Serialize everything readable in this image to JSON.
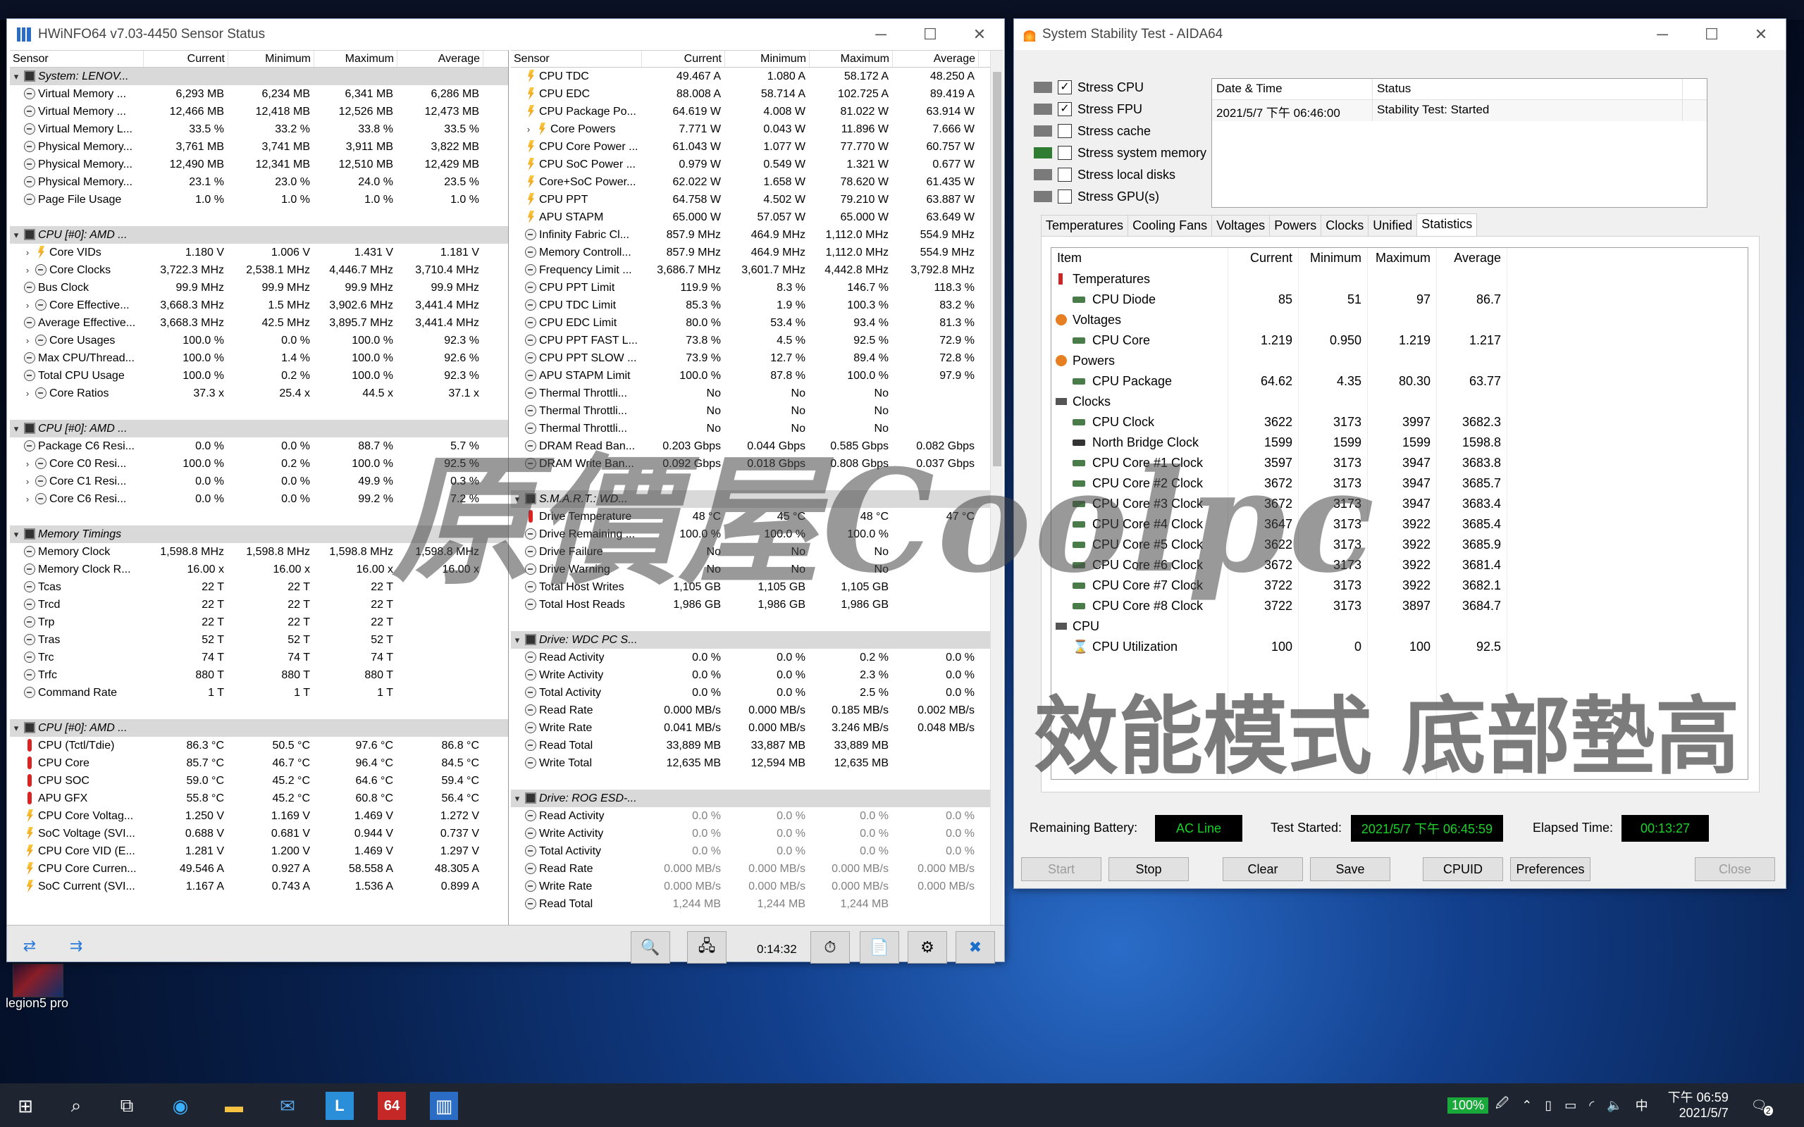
{
  "hwinfo": {
    "title": "HWiNFO64 v7.03-4450 Sensor Status",
    "headers": [
      "Sensor",
      "Current",
      "Minimum",
      "Maximum",
      "Average"
    ],
    "left": [
      {
        "t": "grp",
        "l": "System: LENOV..."
      },
      {
        "t": "clock",
        "l": "Virtual Memory ...",
        "v": [
          "6,293 MB",
          "6,234 MB",
          "6,341 MB",
          "6,286 MB"
        ]
      },
      {
        "t": "clock",
        "l": "Virtual Memory ...",
        "v": [
          "12,466 MB",
          "12,418 MB",
          "12,526 MB",
          "12,473 MB"
        ]
      },
      {
        "t": "clock",
        "l": "Virtual Memory L...",
        "v": [
          "33.5 %",
          "33.2 %",
          "33.8 %",
          "33.5 %"
        ]
      },
      {
        "t": "clock",
        "l": "Physical Memory...",
        "v": [
          "3,761 MB",
          "3,741 MB",
          "3,911 MB",
          "3,822 MB"
        ]
      },
      {
        "t": "clock",
        "l": "Physical Memory...",
        "v": [
          "12,490 MB",
          "12,341 MB",
          "12,510 MB",
          "12,429 MB"
        ]
      },
      {
        "t": "clock",
        "l": "Physical Memory...",
        "v": [
          "23.1 %",
          "23.0 %",
          "24.0 %",
          "23.5 %"
        ]
      },
      {
        "t": "clock",
        "l": "Page File Usage",
        "v": [
          "1.0 %",
          "1.0 %",
          "1.0 %",
          "1.0 %"
        ]
      },
      {
        "t": "blank"
      },
      {
        "t": "grp",
        "l": "CPU [#0]: AMD ..."
      },
      {
        "t": "bolt",
        "x": true,
        "l": "Core VIDs",
        "v": [
          "1.180 V",
          "1.006 V",
          "1.431 V",
          "1.181 V"
        ]
      },
      {
        "t": "clock",
        "x": true,
        "l": "Core Clocks",
        "v": [
          "3,722.3 MHz",
          "2,538.1 MHz",
          "4,446.7 MHz",
          "3,710.4 MHz"
        ]
      },
      {
        "t": "clock",
        "l": "Bus Clock",
        "v": [
          "99.9 MHz",
          "99.9 MHz",
          "99.9 MHz",
          "99.9 MHz"
        ]
      },
      {
        "t": "clock",
        "x": true,
        "l": "Core Effective...",
        "v": [
          "3,668.3 MHz",
          "1.5 MHz",
          "3,902.6 MHz",
          "3,441.4 MHz"
        ]
      },
      {
        "t": "clock",
        "l": "Average Effective...",
        "v": [
          "3,668.3 MHz",
          "42.5 MHz",
          "3,895.7 MHz",
          "3,441.4 MHz"
        ]
      },
      {
        "t": "clock",
        "x": true,
        "l": "Core Usages",
        "v": [
          "100.0 %",
          "0.0 %",
          "100.0 %",
          "92.3 %"
        ]
      },
      {
        "t": "clock",
        "l": "Max CPU/Thread...",
        "v": [
          "100.0 %",
          "1.4 %",
          "100.0 %",
          "92.6 %"
        ]
      },
      {
        "t": "clock",
        "l": "Total CPU Usage",
        "v": [
          "100.0 %",
          "0.2 %",
          "100.0 %",
          "92.3 %"
        ]
      },
      {
        "t": "clock",
        "x": true,
        "l": "Core Ratios",
        "v": [
          "37.3 x",
          "25.4 x",
          "44.5 x",
          "37.1 x"
        ]
      },
      {
        "t": "blank"
      },
      {
        "t": "grp",
        "l": "CPU [#0]: AMD ..."
      },
      {
        "t": "clock",
        "l": "Package C6 Resi...",
        "v": [
          "0.0 %",
          "0.0 %",
          "88.7 %",
          "5.7 %"
        ]
      },
      {
        "t": "clock",
        "x": true,
        "l": "Core C0 Resi...",
        "v": [
          "100.0 %",
          "0.2 %",
          "100.0 %",
          "92.5 %"
        ]
      },
      {
        "t": "clock",
        "x": true,
        "l": "Core C1 Resi...",
        "v": [
          "0.0 %",
          "0.0 %",
          "49.9 %",
          "0.3 %"
        ]
      },
      {
        "t": "clock",
        "x": true,
        "l": "Core C6 Resi...",
        "v": [
          "0.0 %",
          "0.0 %",
          "99.2 %",
          "7.2 %"
        ]
      },
      {
        "t": "blank"
      },
      {
        "t": "grp",
        "l": "Memory Timings"
      },
      {
        "t": "clock",
        "l": "Memory Clock",
        "v": [
          "1,598.8 MHz",
          "1,598.8 MHz",
          "1,598.8 MHz",
          "1,598.8 MHz"
        ]
      },
      {
        "t": "clock",
        "l": "Memory Clock R...",
        "v": [
          "16.00 x",
          "16.00 x",
          "16.00 x",
          "16.00 x"
        ]
      },
      {
        "t": "clock",
        "l": "Tcas",
        "v": [
          "22 T",
          "22 T",
          "22 T",
          ""
        ]
      },
      {
        "t": "clock",
        "l": "Trcd",
        "v": [
          "22 T",
          "22 T",
          "22 T",
          ""
        ]
      },
      {
        "t": "clock",
        "l": "Trp",
        "v": [
          "22 T",
          "22 T",
          "22 T",
          ""
        ]
      },
      {
        "t": "clock",
        "l": "Tras",
        "v": [
          "52 T",
          "52 T",
          "52 T",
          ""
        ]
      },
      {
        "t": "clock",
        "l": "Trc",
        "v": [
          "74 T",
          "74 T",
          "74 T",
          ""
        ]
      },
      {
        "t": "clock",
        "l": "Trfc",
        "v": [
          "880 T",
          "880 T",
          "880 T",
          ""
        ]
      },
      {
        "t": "clock",
        "l": "Command Rate",
        "v": [
          "1 T",
          "1 T",
          "1 T",
          ""
        ]
      },
      {
        "t": "blank"
      },
      {
        "t": "grp",
        "l": "CPU [#0]: AMD ..."
      },
      {
        "t": "therm",
        "l": "CPU (Tctl/Tdie)",
        "v": [
          "86.3 °C",
          "50.5 °C",
          "97.6 °C",
          "86.8 °C"
        ]
      },
      {
        "t": "therm",
        "l": "CPU Core",
        "v": [
          "85.7 °C",
          "46.7 °C",
          "96.4 °C",
          "84.5 °C"
        ]
      },
      {
        "t": "therm",
        "l": "CPU SOC",
        "v": [
          "59.0 °C",
          "45.2 °C",
          "64.6 °C",
          "59.4 °C"
        ]
      },
      {
        "t": "therm",
        "l": "APU GFX",
        "v": [
          "55.8 °C",
          "45.2 °C",
          "60.8 °C",
          "56.4 °C"
        ]
      },
      {
        "t": "bolt",
        "l": "CPU Core Voltag...",
        "v": [
          "1.250 V",
          "1.169 V",
          "1.469 V",
          "1.272 V"
        ]
      },
      {
        "t": "bolt",
        "l": "SoC Voltage (SVI...",
        "v": [
          "0.688 V",
          "0.681 V",
          "0.944 V",
          "0.737 V"
        ]
      },
      {
        "t": "bolt",
        "l": "CPU Core VID (E...",
        "v": [
          "1.281 V",
          "1.200 V",
          "1.469 V",
          "1.297 V"
        ]
      },
      {
        "t": "bolt",
        "l": "CPU Core Curren...",
        "v": [
          "49.546 A",
          "0.927 A",
          "58.558 A",
          "48.305 A"
        ]
      },
      {
        "t": "bolt",
        "l": "SoC Current (SVI...",
        "v": [
          "1.167 A",
          "0.743 A",
          "1.536 A",
          "0.899 A"
        ]
      }
    ],
    "right": [
      {
        "t": "bolt",
        "l": "CPU TDC",
        "v": [
          "49.467 A",
          "1.080 A",
          "58.172 A",
          "48.250 A"
        ]
      },
      {
        "t": "bolt",
        "l": "CPU EDC",
        "v": [
          "88.008 A",
          "58.714 A",
          "102.725 A",
          "89.419 A"
        ]
      },
      {
        "t": "bolt",
        "l": "CPU Package Po...",
        "v": [
          "64.619 W",
          "4.008 W",
          "81.022 W",
          "63.914 W"
        ]
      },
      {
        "t": "bolt",
        "x": true,
        "l": "Core Powers",
        "v": [
          "7.771 W",
          "0.043 W",
          "11.896 W",
          "7.666 W"
        ]
      },
      {
        "t": "bolt",
        "l": "CPU Core Power ...",
        "v": [
          "61.043 W",
          "1.077 W",
          "77.770 W",
          "60.757 W"
        ]
      },
      {
        "t": "bolt",
        "l": "CPU SoC Power ...",
        "v": [
          "0.979 W",
          "0.549 W",
          "1.321 W",
          "0.677 W"
        ]
      },
      {
        "t": "bolt",
        "l": "Core+SoC Power...",
        "v": [
          "62.022 W",
          "1.658 W",
          "78.620 W",
          "61.435 W"
        ]
      },
      {
        "t": "bolt",
        "l": "CPU PPT",
        "v": [
          "64.758 W",
          "4.502 W",
          "79.210 W",
          "63.887 W"
        ]
      },
      {
        "t": "bolt",
        "l": "APU STAPM",
        "v": [
          "65.000 W",
          "57.057 W",
          "65.000 W",
          "63.649 W"
        ]
      },
      {
        "t": "clock",
        "l": "Infinity Fabric Cl...",
        "v": [
          "857.9 MHz",
          "464.9 MHz",
          "1,112.0 MHz",
          "554.9 MHz"
        ]
      },
      {
        "t": "clock",
        "l": "Memory Controll...",
        "v": [
          "857.9 MHz",
          "464.9 MHz",
          "1,112.0 MHz",
          "554.9 MHz"
        ]
      },
      {
        "t": "clock",
        "l": "Frequency Limit ...",
        "v": [
          "3,686.7 MHz",
          "3,601.7 MHz",
          "4,442.8 MHz",
          "3,792.8 MHz"
        ]
      },
      {
        "t": "clock",
        "l": "CPU PPT Limit",
        "v": [
          "119.9 %",
          "8.3 %",
          "146.7 %",
          "118.3 %"
        ]
      },
      {
        "t": "clock",
        "l": "CPU TDC Limit",
        "v": [
          "85.3 %",
          "1.9 %",
          "100.3 %",
          "83.2 %"
        ]
      },
      {
        "t": "clock",
        "l": "CPU EDC Limit",
        "v": [
          "80.0 %",
          "53.4 %",
          "93.4 %",
          "81.3 %"
        ]
      },
      {
        "t": "clock",
        "l": "CPU PPT FAST L...",
        "v": [
          "73.8 %",
          "4.5 %",
          "92.5 %",
          "72.9 %"
        ]
      },
      {
        "t": "clock",
        "l": "CPU PPT SLOW ...",
        "v": [
          "73.9 %",
          "12.7 %",
          "89.4 %",
          "72.8 %"
        ]
      },
      {
        "t": "clock",
        "l": "APU STAPM Limit",
        "v": [
          "100.0 %",
          "87.8 %",
          "100.0 %",
          "97.9 %"
        ]
      },
      {
        "t": "clock",
        "l": "Thermal Throttli...",
        "v": [
          "No",
          "No",
          "No",
          ""
        ]
      },
      {
        "t": "clock",
        "l": "Thermal Throttli...",
        "v": [
          "No",
          "No",
          "No",
          ""
        ]
      },
      {
        "t": "clock",
        "l": "Thermal Throttli...",
        "v": [
          "No",
          "No",
          "No",
          ""
        ]
      },
      {
        "t": "clock",
        "l": "DRAM Read Ban...",
        "v": [
          "0.203 Gbps",
          "0.044 Gbps",
          "0.585 Gbps",
          "0.082 Gbps"
        ]
      },
      {
        "t": "clock",
        "l": "DRAM Write Ban...",
        "v": [
          "0.092 Gbps",
          "0.018 Gbps",
          "0.808 Gbps",
          "0.037 Gbps"
        ]
      },
      {
        "t": "blank"
      },
      {
        "t": "grp",
        "l": "S.M.A.R.T.: WD..."
      },
      {
        "t": "therm",
        "l": "Drive Temperature",
        "v": [
          "48 °C",
          "45 °C",
          "48 °C",
          "47 °C"
        ]
      },
      {
        "t": "clock",
        "l": "Drive Remaining ...",
        "v": [
          "100.0 %",
          "100.0 %",
          "100.0 %",
          ""
        ]
      },
      {
        "t": "clock",
        "l": "Drive Failure",
        "v": [
          "No",
          "No",
          "No",
          ""
        ]
      },
      {
        "t": "clock",
        "l": "Drive Warning",
        "v": [
          "No",
          "No",
          "No",
          ""
        ]
      },
      {
        "t": "clock",
        "l": "Total Host Writes",
        "v": [
          "1,105 GB",
          "1,105 GB",
          "1,105 GB",
          ""
        ]
      },
      {
        "t": "clock",
        "l": "Total Host Reads",
        "v": [
          "1,986 GB",
          "1,986 GB",
          "1,986 GB",
          ""
        ]
      },
      {
        "t": "blank"
      },
      {
        "t": "grp",
        "l": "Drive: WDC PC S..."
      },
      {
        "t": "clock",
        "l": "Read Activity",
        "v": [
          "0.0 %",
          "0.0 %",
          "0.2 %",
          "0.0 %"
        ]
      },
      {
        "t": "clock",
        "l": "Write Activity",
        "v": [
          "0.0 %",
          "0.0 %",
          "2.3 %",
          "0.0 %"
        ]
      },
      {
        "t": "clock",
        "l": "Total Activity",
        "v": [
          "0.0 %",
          "0.0 %",
          "2.5 %",
          "0.0 %"
        ]
      },
      {
        "t": "clock",
        "l": "Read Rate",
        "v": [
          "0.000 MB/s",
          "0.000 MB/s",
          "0.185 MB/s",
          "0.002 MB/s"
        ]
      },
      {
        "t": "clock",
        "l": "Write Rate",
        "v": [
          "0.041 MB/s",
          "0.000 MB/s",
          "3.246 MB/s",
          "0.048 MB/s"
        ]
      },
      {
        "t": "clock",
        "l": "Read Total",
        "v": [
          "33,889 MB",
          "33,887 MB",
          "33,889 MB",
          ""
        ]
      },
      {
        "t": "clock",
        "l": "Write Total",
        "v": [
          "12,635 MB",
          "12,594 MB",
          "12,635 MB",
          ""
        ]
      },
      {
        "t": "blank"
      },
      {
        "t": "grp",
        "l": "Drive: ROG ESD-..."
      },
      {
        "t": "clock",
        "d": true,
        "l": "Read Activity",
        "v": [
          "0.0 %",
          "0.0 %",
          "0.0 %",
          "0.0 %"
        ]
      },
      {
        "t": "clock",
        "d": true,
        "l": "Write Activity",
        "v": [
          "0.0 %",
          "0.0 %",
          "0.0 %",
          "0.0 %"
        ]
      },
      {
        "t": "clock",
        "d": true,
        "l": "Total Activity",
        "v": [
          "0.0 %",
          "0.0 %",
          "0.0 %",
          "0.0 %"
        ]
      },
      {
        "t": "clock",
        "d": true,
        "l": "Read Rate",
        "v": [
          "0.000 MB/s",
          "0.000 MB/s",
          "0.000 MB/s",
          "0.000 MB/s"
        ]
      },
      {
        "t": "clock",
        "d": true,
        "l": "Write Rate",
        "v": [
          "0.000 MB/s",
          "0.000 MB/s",
          "0.000 MB/s",
          "0.000 MB/s"
        ]
      },
      {
        "t": "clock",
        "d": true,
        "l": "Read Total",
        "v": [
          "1,244 MB",
          "1,244 MB",
          "1,244 MB",
          ""
        ]
      }
    ],
    "elapsed": "0:14:32"
  },
  "aida": {
    "title": "System Stability Test - AIDA64",
    "stress": [
      {
        "label": "Stress CPU",
        "checked": true
      },
      {
        "label": "Stress FPU",
        "checked": true
      },
      {
        "label": "Stress cache",
        "checked": false
      },
      {
        "label": "Stress system memory",
        "checked": false
      },
      {
        "label": "Stress local disks",
        "checked": false
      },
      {
        "label": "Stress GPU(s)",
        "checked": false
      }
    ],
    "log_headers": [
      "Date & Time",
      "Status"
    ],
    "log_rows": [
      {
        "time": "2021/5/7 下午 06:46:00",
        "status": "Stability Test: Started"
      }
    ],
    "tabs": [
      "Temperatures",
      "Cooling Fans",
      "Voltages",
      "Powers",
      "Clocks",
      "Unified",
      "Statistics"
    ],
    "active_tab": "Statistics",
    "stat_headers": [
      "Item",
      "Current",
      "Minimum",
      "Maximum",
      "Average"
    ],
    "stats": [
      {
        "g": true,
        "i": "therm",
        "n": "Temperatures"
      },
      {
        "n": "CPU Diode",
        "v": [
          "85",
          "51",
          "97",
          "86.7"
        ]
      },
      {
        "g": true,
        "i": "bolt",
        "n": "Voltages"
      },
      {
        "n": "CPU Core",
        "v": [
          "1.219",
          "0.950",
          "1.219",
          "1.217"
        ]
      },
      {
        "g": true,
        "i": "bolt",
        "n": "Powers"
      },
      {
        "n": "CPU Package",
        "v": [
          "64.62",
          "4.35",
          "80.30",
          "63.77"
        ]
      },
      {
        "g": true,
        "i": "chip",
        "n": "Clocks"
      },
      {
        "n": "CPU Clock",
        "v": [
          "3622",
          "3173",
          "3997",
          "3682.3"
        ]
      },
      {
        "n": "North Bridge Clock",
        "dark": true,
        "v": [
          "1599",
          "1599",
          "1599",
          "1598.8"
        ]
      },
      {
        "n": "CPU Core #1 Clock",
        "v": [
          "3597",
          "3173",
          "3947",
          "3683.8"
        ]
      },
      {
        "n": "CPU Core #2 Clock",
        "v": [
          "3672",
          "3173",
          "3947",
          "3685.7"
        ]
      },
      {
        "n": "CPU Core #3 Clock",
        "v": [
          "3672",
          "3173",
          "3947",
          "3683.4"
        ]
      },
      {
        "n": "CPU Core #4 Clock",
        "v": [
          "3647",
          "3173",
          "3922",
          "3685.4"
        ]
      },
      {
        "n": "CPU Core #5 Clock",
        "v": [
          "3622",
          "3173",
          "3922",
          "3685.9"
        ]
      },
      {
        "n": "CPU Core #6 Clock",
        "v": [
          "3672",
          "3173",
          "3922",
          "3681.4"
        ]
      },
      {
        "n": "CPU Core #7 Clock",
        "v": [
          "3722",
          "3173",
          "3922",
          "3682.1"
        ]
      },
      {
        "n": "CPU Core #8 Clock",
        "v": [
          "3722",
          "3173",
          "3897",
          "3684.7"
        ]
      },
      {
        "g": true,
        "i": "chip",
        "n": "CPU"
      },
      {
        "n": "CPU Utilization",
        "hourglass": true,
        "v": [
          "100",
          "0",
          "100",
          "92.5"
        ]
      }
    ],
    "remaining_battery_label": "Remaining Battery:",
    "remaining_battery": "AC Line",
    "test_started_label": "Test Started:",
    "test_started": "2021/5/7 下午 06:45:59",
    "elapsed_label": "Elapsed Time:",
    "elapsed": "00:13:27",
    "buttons": {
      "start": "Start",
      "stop": "Stop",
      "clear": "Clear",
      "save": "Save",
      "cpuid": "CPUID",
      "preferences": "Preferences",
      "close": "Close"
    }
  },
  "overlay": {
    "watermark": "原價屋Coolpc",
    "caption": "效能模式 底部墊高"
  },
  "desktop": {
    "icon_label": "legion5 pro"
  },
  "taskbar": {
    "battery": "100%",
    "ime": "中",
    "time": "下午 06:59",
    "date": "2021/5/7",
    "notif": "2"
  },
  "colors": {
    "lcd_green": "#19d22a",
    "group_row": "#d9d9d9",
    "taskbar": "#1e2530"
  }
}
